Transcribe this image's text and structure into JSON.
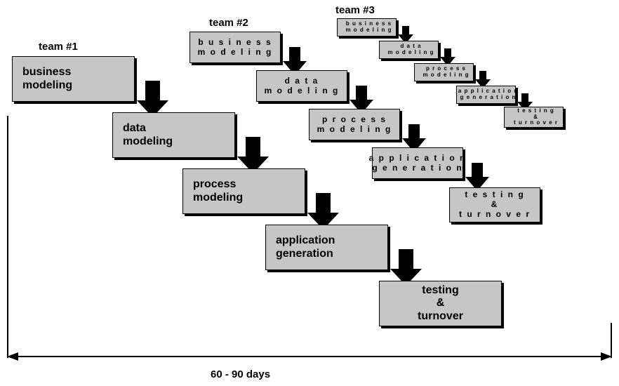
{
  "teams": {
    "t1": {
      "label": "team #1"
    },
    "t2": {
      "label": "team #2"
    },
    "t3": {
      "label": "team #3"
    }
  },
  "phases": {
    "business": "business\nmodeling",
    "data": "data\nmodeling",
    "process": "process\nmodeling",
    "application": "application\ngeneration",
    "testing": "testing\n&\nturnover"
  },
  "phases_spaced": {
    "business": "b u s i n e s s\nm o d e l i n g",
    "data": "d a t a\nm o d e l i n g",
    "process": "p r o c e s s\nm o d e l i n g",
    "application": "a p p l i c a t i o n\ng e n e r a t i o n",
    "testing": "t e s t i n g\n&\nt u r n o v e r"
  },
  "timeline": {
    "label": "60 - 90 days"
  }
}
